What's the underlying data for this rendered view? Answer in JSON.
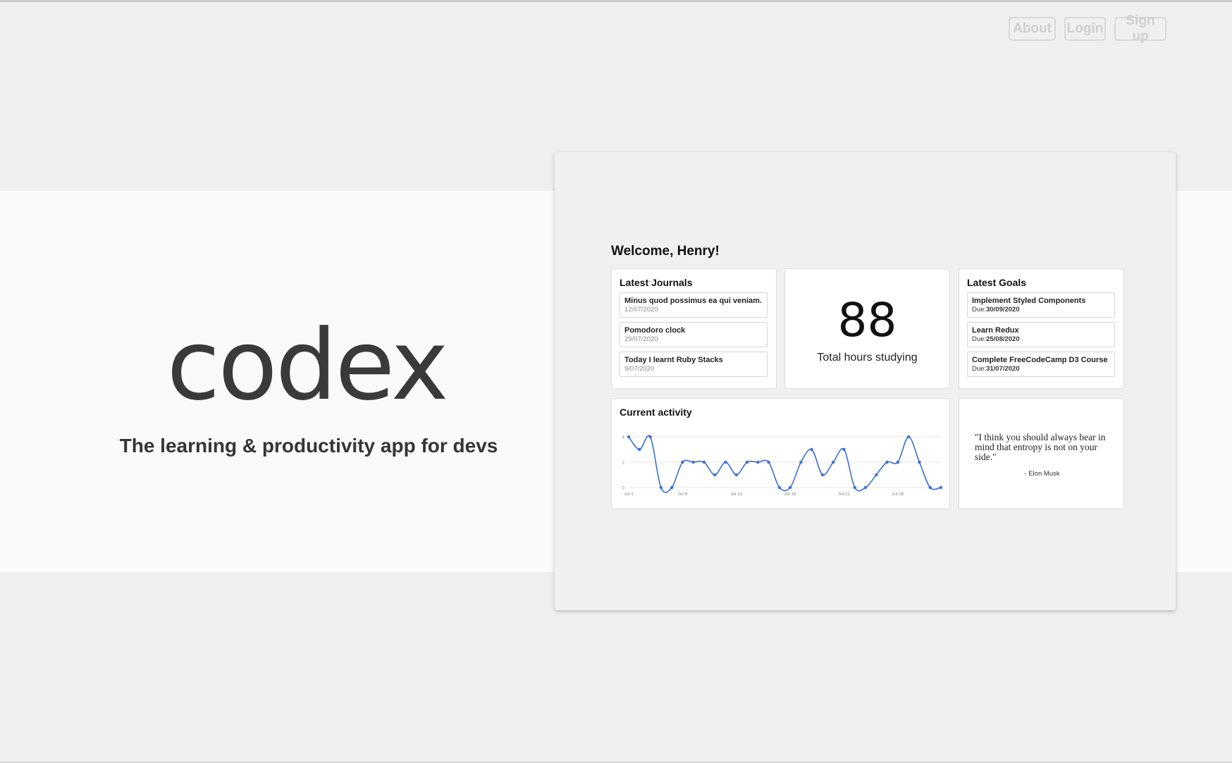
{
  "nav": {
    "about": "About",
    "login": "Login",
    "signup": "Sign up"
  },
  "brand": {
    "logo": "codex",
    "tagline": "The learning & productivity app for devs"
  },
  "dashboard": {
    "welcome": "Welcome, Henry!",
    "journals": {
      "title": "Latest Journals",
      "items": [
        {
          "title": "Minus quod possimus ea qui veniam.",
          "date": "12/07/2020"
        },
        {
          "title": "Pomodoro clock",
          "date": "29/07/2020"
        },
        {
          "title": "Today I learnt Ruby Stacks",
          "date": "9/07/2020"
        }
      ]
    },
    "hours": {
      "value": "88",
      "label": "Total hours studying"
    },
    "goals": {
      "title": "Latest Goals",
      "due_prefix": "Due:",
      "items": [
        {
          "title": "Implement Styled Components",
          "due": "30/09/2020"
        },
        {
          "title": "Learn Redux",
          "due": "25/08/2020"
        },
        {
          "title": "Complete FreeCodeCamp D3 Course",
          "due": "31/07/2020"
        }
      ]
    },
    "activity": {
      "title": "Current activity"
    },
    "quote": {
      "text": "\"I think you should always bear in mind that entropy is not on your side.\"",
      "author": "- Elon Musk"
    }
  },
  "chart_data": {
    "type": "line",
    "x": [
      "Jul 1",
      "Jul 2",
      "Jul 3",
      "Jul 4",
      "Jul 5",
      "Jul 6",
      "Jul 7",
      "Jul 8",
      "Jul 9",
      "Jul 10",
      "Jul 11",
      "Jul 12",
      "Jul 13",
      "Jul 14",
      "Jul 15",
      "Jul 16",
      "Jul 17",
      "Jul 18",
      "Jul 19",
      "Jul 20",
      "Jul 21",
      "Jul 22",
      "Jul 23",
      "Jul 24",
      "Jul 25",
      "Jul 26",
      "Jul 27",
      "Jul 28",
      "Jul 29",
      "Jul 30"
    ],
    "series": [
      {
        "values": [
          4,
          3,
          4,
          0,
          0,
          2,
          2,
          2,
          1,
          2,
          1,
          2,
          2,
          2,
          0,
          0,
          2,
          3,
          1,
          2,
          3,
          0,
          0,
          1,
          2,
          2,
          4,
          2,
          0,
          0
        ]
      }
    ],
    "x_tick_labels": [
      "Jul 1",
      "Jul 6",
      "Jul 11",
      "Jul 16",
      "Jul 21",
      "Jul 26"
    ],
    "y_ticks": [
      0,
      2,
      4
    ],
    "ylim": [
      0,
      4
    ],
    "grid": true,
    "color": "#3b6fd4"
  }
}
